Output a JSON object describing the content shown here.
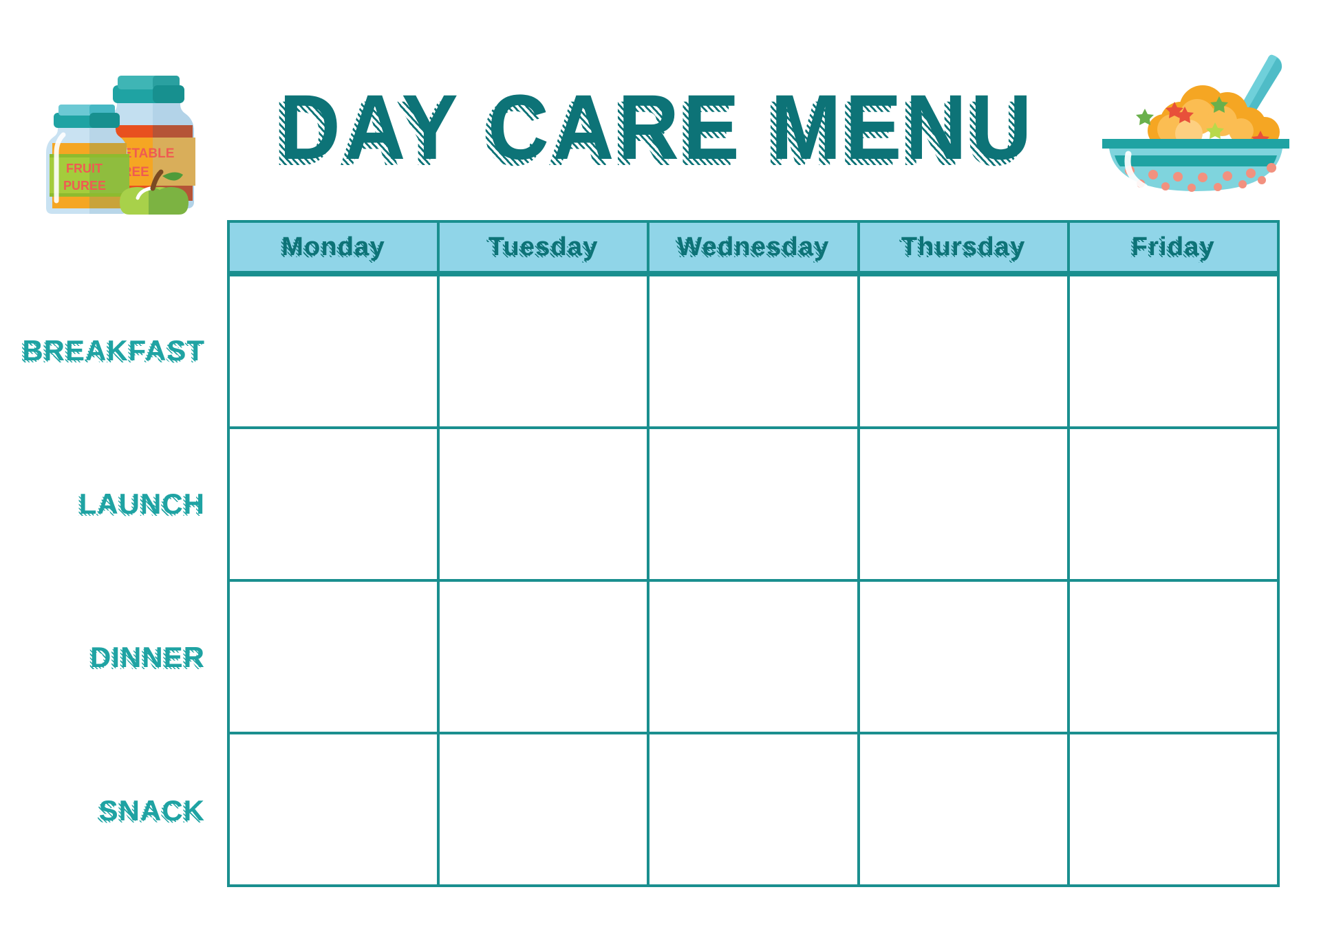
{
  "page": {
    "title": "DAY CARE MENU",
    "background_color": "#ffffff"
  },
  "colors": {
    "title_teal": "#0d7377",
    "header_bg": "#90d5e8",
    "grid_border": "#1a8f8f",
    "row_label_teal": "#1fa3a3",
    "cell_bg": "#ffffff"
  },
  "table": {
    "day_headers": [
      {
        "label": "Monday"
      },
      {
        "label": "Tuesday"
      },
      {
        "label": "Wednesday"
      },
      {
        "label": "Thursday"
      },
      {
        "label": "Friday"
      }
    ],
    "meal_rows": [
      {
        "label": "BREAKFAST",
        "cells": [
          "",
          "",
          "",
          "",
          ""
        ]
      },
      {
        "label": "LAUNCH",
        "cells": [
          "",
          "",
          "",
          "",
          ""
        ]
      },
      {
        "label": "DINNER",
        "cells": [
          "",
          "",
          "",
          "",
          ""
        ]
      },
      {
        "label": "SNACK",
        "cells": [
          "",
          "",
          "",
          "",
          ""
        ]
      }
    ]
  },
  "illustrations": {
    "left": {
      "name": "baby-food-jars-and-apple",
      "jar_front_label_line1": "FRUIT",
      "jar_front_label_line2": "PUREE",
      "jar_back_label_line1": "VEGETABLE",
      "jar_back_label_line2": "PUREE"
    },
    "right": {
      "name": "bowl-of-food-with-spoon"
    }
  }
}
